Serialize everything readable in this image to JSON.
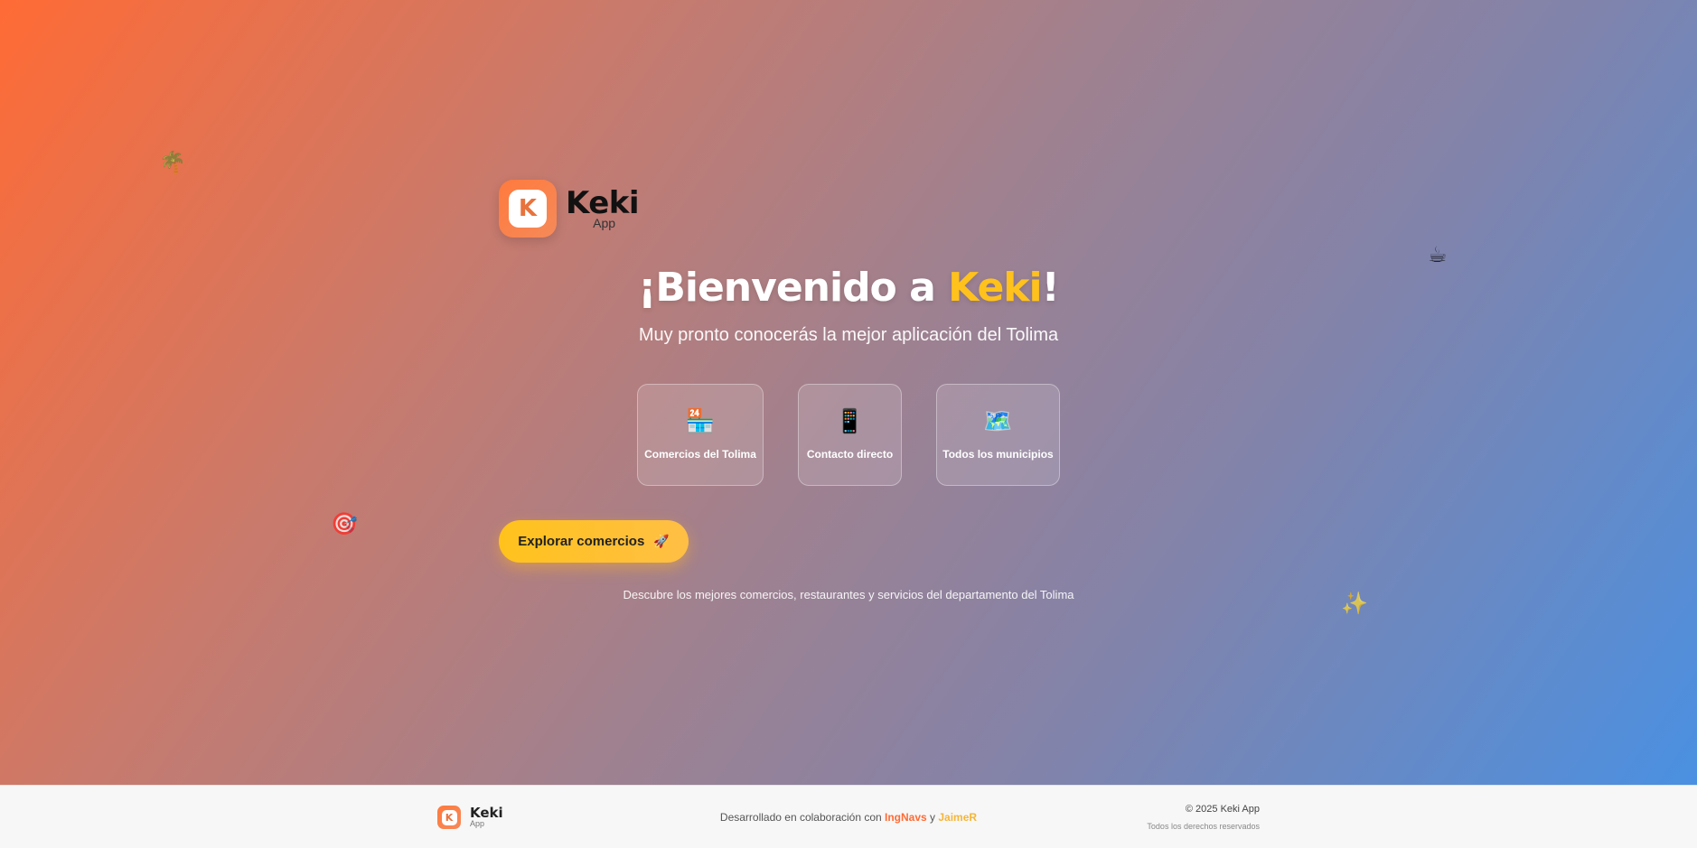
{
  "brand": {
    "name": "Keki",
    "sub": "App",
    "initial": "K"
  },
  "hero": {
    "title_prefix": "¡Bienvenido a ",
    "title_brand": "Keki",
    "title_suffix": "!",
    "subtitle": "Muy pronto conocerás la mejor aplicación del Tolima",
    "features": [
      {
        "icon": "convenience-store-icon",
        "glyph": "🏪",
        "label": "Comercios del Tolima"
      },
      {
        "icon": "mobile-phone-icon",
        "glyph": "📱",
        "label": "Contacto directo"
      },
      {
        "icon": "map-icon",
        "glyph": "🗺️",
        "label": "Todos los municipios"
      }
    ],
    "cta_label": "Explorar comercios",
    "cta_icon": "🚀",
    "tagline": "Descubre los mejores comercios, restaurantes y servicios del departamento del Tolima",
    "floating": [
      "🌴",
      "☕",
      "🎯",
      "✨"
    ]
  },
  "footer": {
    "brand_name": "Keki",
    "brand_sub": "App",
    "credits_prefix": "Desarrollado en colaboración con ",
    "partner1": "IngNavs",
    "joiner": " y ",
    "partner2": "JaimeR",
    "copyright": "© 2025 Keki App",
    "rights": "Todos los derechos reservados"
  },
  "colors": {
    "accent_orange": "#ff6b35",
    "accent_yellow": "#ffc21c",
    "accent_blue": "#4a90e2"
  }
}
